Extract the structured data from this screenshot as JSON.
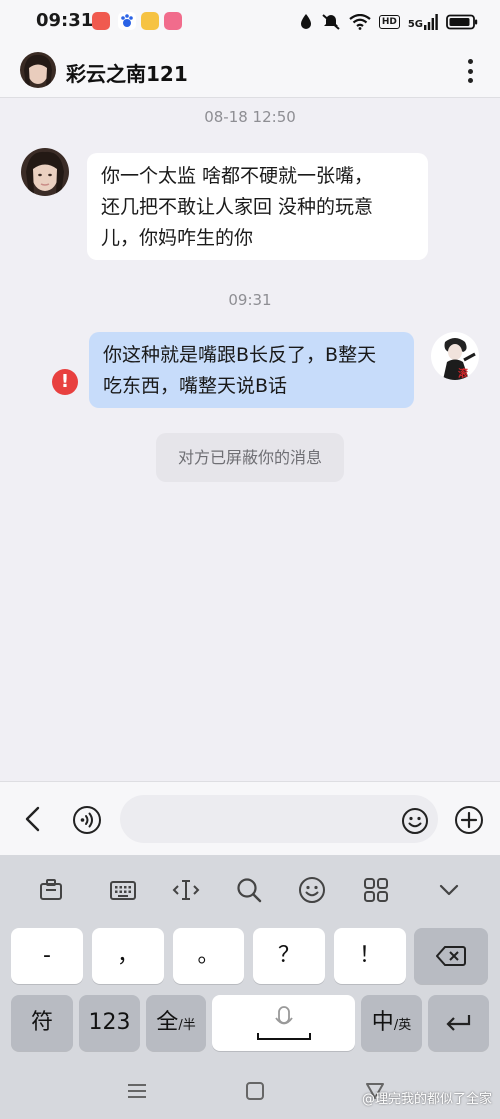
{
  "status_bar": {
    "time": "09:31",
    "hd_label": "HD",
    "network_label": "5G",
    "app_icons": [
      "music-app-icon",
      "baidu-app-icon",
      "notes-app-icon",
      "vlog-app-icon"
    ],
    "icons": [
      "location-icon",
      "mute-icon",
      "wifi-icon",
      "signal-icon",
      "battery-icon"
    ]
  },
  "header": {
    "title": "彩云之南121",
    "more_icon": "more-vertical-icon"
  },
  "chat": {
    "messages": [
      {
        "timestamp": "08-18 12:50",
        "direction": "incoming",
        "lines": [
          "你一个太监  啥都不硬就一张嘴，",
          "还几把不敢让人家回  没种的玩意",
          "儿，你妈咋生的你"
        ]
      },
      {
        "timestamp": "09:31",
        "direction": "outgoing",
        "status": "failed",
        "lines": [
          "你这种就是嘴跟B长反了，B整天",
          "吃东西，嘴整天说B话"
        ]
      }
    ],
    "system_notice": "对方已屏蔽你的消息",
    "sender_avatar_char": "滚"
  },
  "input_bar": {
    "placeholder": "",
    "icons": [
      "back-icon",
      "voice-icon",
      "emoji-icon",
      "add-icon"
    ]
  },
  "keyboard": {
    "toolbar": [
      "clipboard-icon",
      "keyboard-icon",
      "cursor-icon",
      "search-icon",
      "emoji-icon",
      "grid-icon",
      "collapse-icon"
    ],
    "row1": [
      "-",
      "，",
      "。",
      "？",
      "！"
    ],
    "row2": {
      "symbols": "符",
      "numbers": "123",
      "full_main": "全",
      "full_sub": "/半",
      "lang_main": "中",
      "lang_sub": "/英"
    }
  },
  "nav_bar": {
    "icons": [
      "menu-icon",
      "home-icon",
      "back-triangle-icon"
    ]
  },
  "watermark": "@理完我的都似了全家",
  "colors": {
    "background": "#f0eff4",
    "incoming_bubble": "#ffffff",
    "outgoing_bubble": "#c7dcfa",
    "error": "#e8403f",
    "keyboard": "#d6d8dd"
  }
}
